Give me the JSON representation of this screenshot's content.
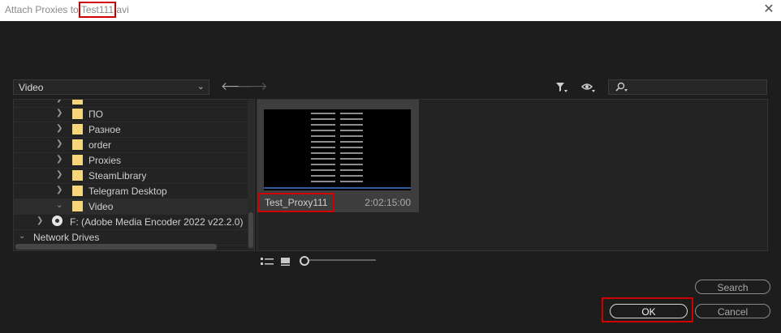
{
  "window": {
    "title_prefix": "Attach Proxies to ",
    "title_filename": "Test111",
    "title_extension": ".avi",
    "close_glyph": "✕"
  },
  "toolbar": {
    "location": "Video",
    "chevron": "⌄",
    "back_glyph": "🡐",
    "forward_glyph": "🡒",
    "search_value": ""
  },
  "tree": {
    "items": [
      {
        "label": "ПО"
      },
      {
        "label": "Разное"
      },
      {
        "label": "order"
      },
      {
        "label": "Proxies"
      },
      {
        "label": "SteamLibrary"
      },
      {
        "label": "Telegram Desktop"
      },
      {
        "label": "Video",
        "expanded": true,
        "selected": true
      },
      {
        "label": "F: (Adobe Media Encoder 2022 v22.2.0)"
      },
      {
        "label": "Network Drives"
      }
    ]
  },
  "files": {
    "items": [
      {
        "name": "Test_Proxy111",
        "duration": "2:02:15:00"
      }
    ]
  },
  "buttons": {
    "search": "Search",
    "ok": "OK",
    "cancel": "Cancel"
  },
  "colors": {
    "background": "#1d1d1d",
    "folder": "#f5d67a",
    "highlight": "#d00000"
  },
  "icons": [
    "close-icon",
    "back-icon",
    "forward-icon",
    "filter-icon",
    "eye-icon",
    "search-icon",
    "folder-icon",
    "drive-icon",
    "list-view-icon",
    "icon-view-icon"
  ]
}
